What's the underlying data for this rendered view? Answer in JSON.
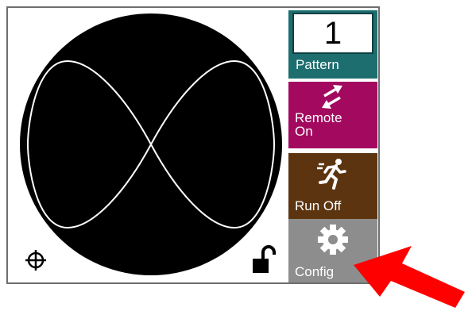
{
  "pattern": {
    "number": "1",
    "label": "Pattern"
  },
  "remote": {
    "label_line1": "Remote",
    "label_line2": "On",
    "icon": "swap-arrows-icon"
  },
  "run": {
    "label": "Run Off",
    "icon": "running-person-icon"
  },
  "config": {
    "label": "Config",
    "icon": "gear-icon"
  },
  "status_icons": {
    "left": "crosshair-icon",
    "right": "unlocked-padlock-icon"
  },
  "colors": {
    "pattern_bg": "#1d6e6f",
    "remote_bg": "#a3095f",
    "run_bg": "#5c3510",
    "config_bg": "#8d8d8d",
    "annotation_arrow": "#ff0000"
  }
}
